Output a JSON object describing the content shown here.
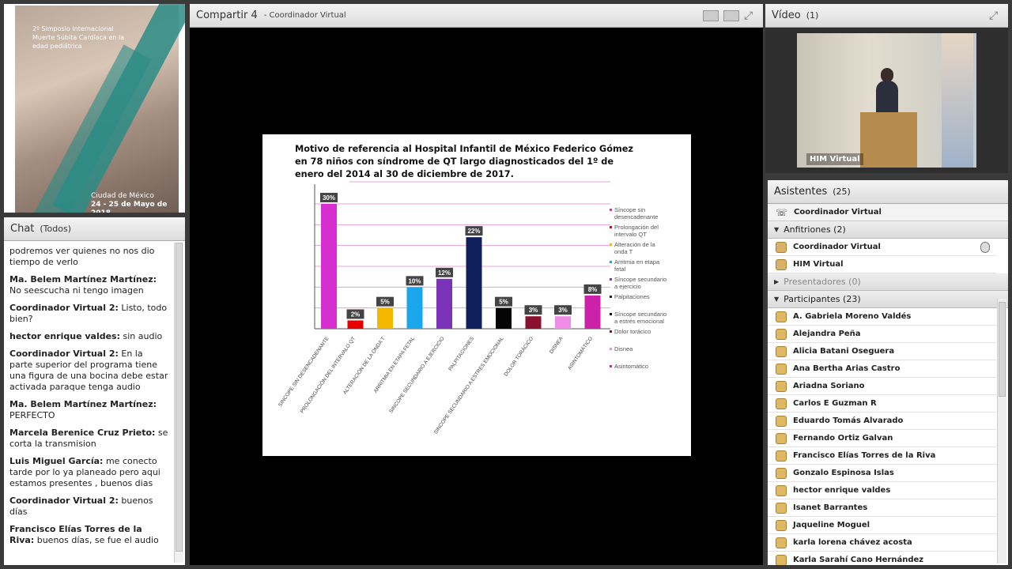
{
  "banner": {
    "line1": "2º Simposio Internacional",
    "line2": "Muerte Súbita Cardíaca en la",
    "line3": "edad pediátrica",
    "city": "Ciudad de México",
    "dates": "24 - 25 de Mayo de 2018"
  },
  "chat": {
    "title": "Chat",
    "scope": "(Todos)",
    "messages": [
      {
        "sender": "",
        "text": "podremos ver quienes no nos dio tiempo de verlo"
      },
      {
        "sender": "Ma. Belem Martínez Martínez:",
        "text": " No seescucha ni tengo imagen"
      },
      {
        "sender": "Coordinador Virtual 2:",
        "text": " Listo, todo bien?"
      },
      {
        "sender": "hector enrique valdes:",
        "text": " sin audio"
      },
      {
        "sender": "Coordinador Virtual 2:",
        "text": " En la parte superior del programa tiene una figura de una bocina debe estar activada paraque tenga audio"
      },
      {
        "sender": "Ma. Belem Martínez Martínez:",
        "text": " PERFECTO"
      },
      {
        "sender": "Marcela Berenice  Cruz Prieto:",
        "text": " se corta la transmision"
      },
      {
        "sender": "Luis Miguel García:",
        "text": " me conecto tarde por lo ya planeado pero aqui estamos presentes , buenos dias"
      },
      {
        "sender": "Coordinador Virtual 2:",
        "text": " buenos días"
      },
      {
        "sender": "Francisco Elías  Torres de la Riva:",
        "text": " buenos días, se fue el audio"
      }
    ]
  },
  "share": {
    "title": "Compartir 4",
    "subtitle": "- Coordinador Virtual"
  },
  "slide": {
    "title": "Motivo de referencia al Hospital Infantil de México Federico Gómez en 78 niños con síndrome de QT largo diagnosticados del 1º de enero del 2014 al 30 de diciembre de 2017."
  },
  "chart_data": {
    "type": "bar",
    "title": "Motivo de referencia al Hospital Infantil de México Federico Gómez en 78 niños con síndrome de QT largo diagnosticados del 1º de enero del 2014 al 30 de diciembre de 2017.",
    "categories": [
      "SINCOPE SIN DESENCADENANTE",
      "PROLONGACIÓN DEL INTERVALO QT",
      "ALTERACIÓN DE LA ONDA T",
      "ARRITMIA EN ETAPA FETAL",
      "SINCOPE SECUNDARIO A EJERCICIO",
      "PALPITACIONES",
      "SINCOPE SECUNDARIO A ESTRES EMOCIONAL",
      "DOLOR TORÁCICO",
      "DISNEA",
      "ASINTOMÁTICO"
    ],
    "values": [
      30,
      2,
      5,
      10,
      12,
      22,
      5,
      3,
      3,
      8
    ],
    "value_labels": [
      "30%",
      "2%",
      "5%",
      "10%",
      "12%",
      "22%",
      "5%",
      "3%",
      "3%",
      "8%"
    ],
    "colors": [
      "#d62fd0",
      "#e60000",
      "#f5b800",
      "#1aa6ea",
      "#7a33b8",
      "#0e1f5c",
      "#050505",
      "#8a1030",
      "#ee8ce6",
      "#cc22aa"
    ],
    "legend": [
      "Síncope sin desencadenante",
      "Prolongación del intervalo QT",
      "Alteración de la onda T",
      "Arritmia en etapa fetal",
      "Síncope secundario a ejercicio",
      "Palpitaciones",
      "Síncope secundario a estrés emocional",
      "Dolor torácico",
      "Disnea",
      "Asintomático"
    ],
    "legend_position": "right",
    "ylim": [
      0,
      30
    ],
    "grid": true
  },
  "video": {
    "title": "Vídeo",
    "count": "(1)",
    "label": "HIM Virtual"
  },
  "attendees": {
    "title": "Asistentes",
    "count": "(25)",
    "coordinator": "Coordinador Virtual",
    "hosts_label": "Anfitriones (2)",
    "hosts": [
      "Coordinador Virtual",
      "HIM Virtual"
    ],
    "presenters_label": "Presentadores (0)",
    "participants_label": "Participantes (23)",
    "participants": [
      "A. Gabriela Moreno Valdés",
      "Alejandra Peña",
      "Alicia Batani Oseguera",
      "Ana Bertha Arias Castro",
      "Ariadna Soriano",
      "Carlos E Guzman R",
      "Eduardo Tomás Alvarado",
      "Fernando Ortiz Galvan",
      "Francisco Elías  Torres de la Riva",
      "Gonzalo Espinosa Islas",
      "hector enrique valdes",
      "Isanet Barrantes",
      "Jaqueline  Moguel",
      "karla lorena chávez acosta",
      "Karla Sarahí Cano Hernández"
    ]
  }
}
